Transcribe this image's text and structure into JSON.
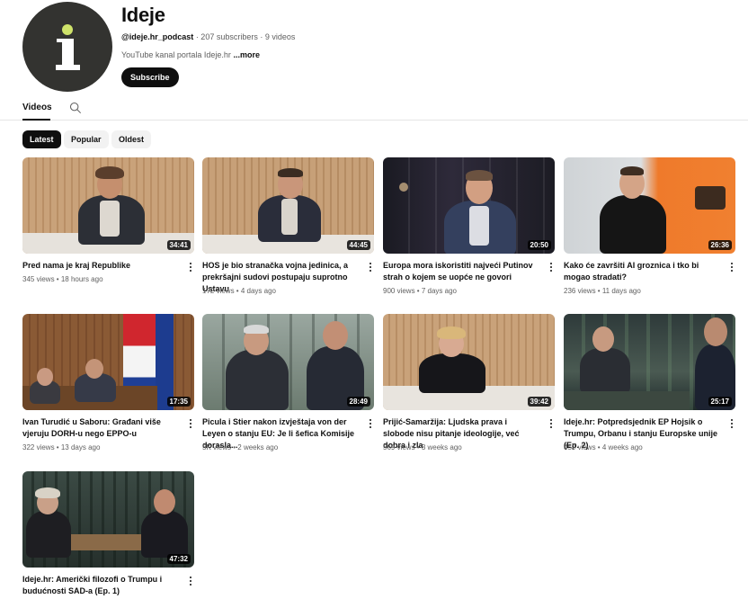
{
  "channel": {
    "name": "Ideje",
    "handle": "@ideje.hr_podcast",
    "stats": "· 207 subscribers · 9 videos",
    "description": "YouTube kanal portala Ideje.hr",
    "more": "...more",
    "subscribe": "Subscribe",
    "avatar_icon": "ideje-logo-icon"
  },
  "tabs": {
    "videos": "Videos",
    "search_icon": "search-icon"
  },
  "chips": [
    "Latest",
    "Popular",
    "Oldest"
  ],
  "videos": [
    {
      "title": "Pred nama je kraj Republike",
      "views": "345 views",
      "age": "18 hours ago",
      "duration": "34:41"
    },
    {
      "title": "HOS je bio stranačka vojna jedinica, a prekršajni sudovi postupaju suprotno Ustavu",
      "views": "172 views",
      "age": "4 days ago",
      "duration": "44:45"
    },
    {
      "title": "Europa mora iskoristiti najveći Putinov strah o kojem se uopće ne govori",
      "views": "900 views",
      "age": "7 days ago",
      "duration": "20:50"
    },
    {
      "title": "Kako će završiti AI groznica i tko bi mogao stradati?",
      "views": "236 views",
      "age": "11 days ago",
      "duration": "26:36"
    },
    {
      "title": "Ivan Turudić u Saboru: Građani više vjeruju DORH-u nego EPPO-u",
      "views": "322 views",
      "age": "13 days ago",
      "duration": "17:35"
    },
    {
      "title": "Picula i Stier nakon izvještaja von der Leyen o stanju EU: Je li šefica Komisije dorasla...",
      "views": "5K views",
      "age": "2 weeks ago",
      "duration": "28:49"
    },
    {
      "title": "Prijić-Samaržija: Ljudska prava i slobode nisu pitanje ideologije, već dobra i zla",
      "views": "569 views",
      "age": "3 weeks ago",
      "duration": "39:42"
    },
    {
      "title": "Ideje.hr: Potpredsjednik EP Hojsik o Trumpu, Orbanu i stanju Europske unije (Ep. 2)",
      "views": "459 views",
      "age": "4 weeks ago",
      "duration": "25:17"
    },
    {
      "title": "Ideje.hr: Američki filozofi o Trumpu i budućnosti SAD-a (Ep. 1)",
      "views": "",
      "age": "",
      "duration": "47:32"
    }
  ]
}
